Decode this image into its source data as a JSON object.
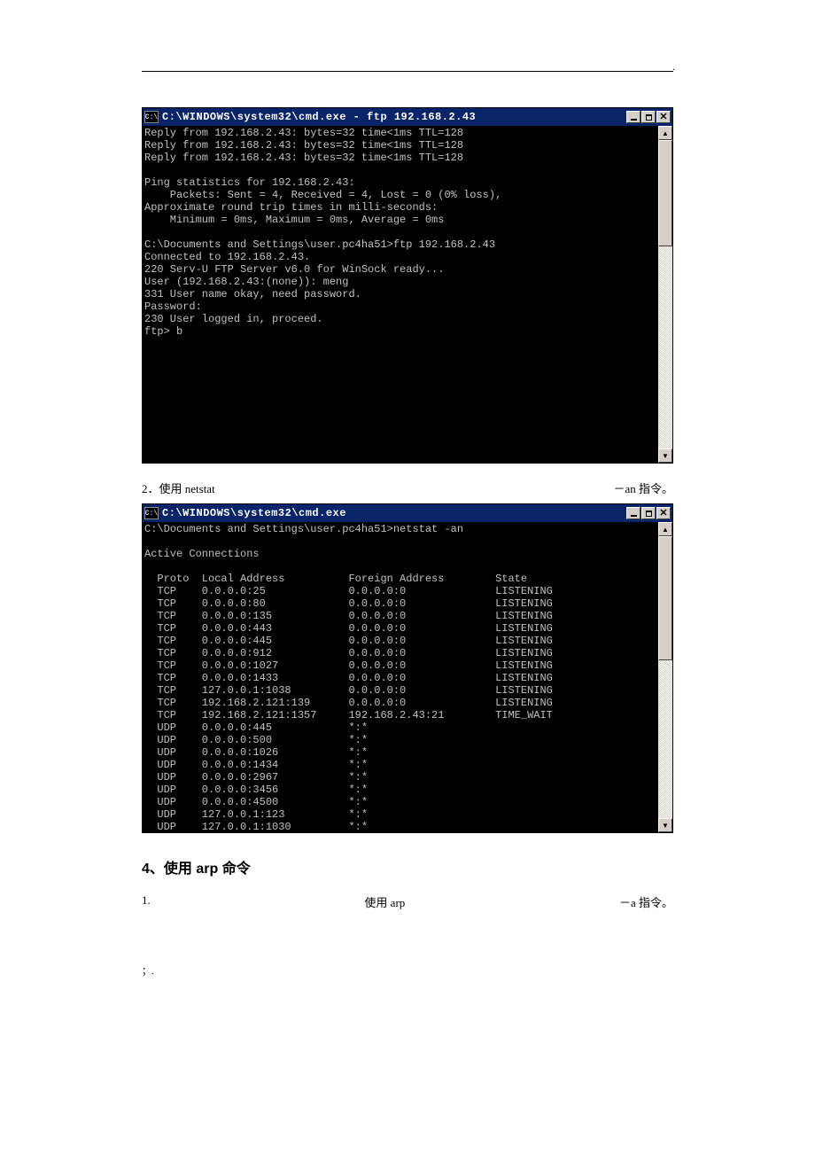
{
  "page_dot": ".",
  "cmd1": {
    "icon": "C:\\",
    "title": "C:\\WINDOWS\\system32\\cmd.exe - ftp 192.168.2.43",
    "lines": [
      "Reply from 192.168.2.43: bytes=32 time<1ms TTL=128",
      "Reply from 192.168.2.43: bytes=32 time<1ms TTL=128",
      "Reply from 192.168.2.43: bytes=32 time<1ms TTL=128",
      "",
      "Ping statistics for 192.168.2.43:",
      "    Packets: Sent = 4, Received = 4, Lost = 0 (0% loss),",
      "Approximate round trip times in milli-seconds:",
      "    Minimum = 0ms, Maximum = 0ms, Average = 0ms",
      "",
      "C:\\Documents and Settings\\user.pc4ha51>ftp 192.168.2.43",
      "Connected to 192.168.2.43.",
      "220 Serv-U FTP Server v6.0 for WinSock ready...",
      "User (192.168.2.43:(none)): meng",
      "331 User name okay, need password.",
      "Password:",
      "230 User logged in, proceed.",
      "ftp> b"
    ]
  },
  "step2": {
    "left": "2．使用 netstat",
    "right": "－an 指令。"
  },
  "cmd2": {
    "icon": "C:\\",
    "title": "C:\\WINDOWS\\system32\\cmd.exe",
    "prompt": "C:\\Documents and Settings\\user.pc4ha51>netstat -an",
    "heading": "Active Connections",
    "columns": {
      "c1": "Proto",
      "c2": "Local Address",
      "c3": "Foreign Address",
      "c4": "State"
    },
    "rows": [
      {
        "proto": "TCP",
        "local": "0.0.0.0:25",
        "foreign": "0.0.0.0:0",
        "state": "LISTENING"
      },
      {
        "proto": "TCP",
        "local": "0.0.0.0:80",
        "foreign": "0.0.0.0:0",
        "state": "LISTENING"
      },
      {
        "proto": "TCP",
        "local": "0.0.0.0:135",
        "foreign": "0.0.0.0:0",
        "state": "LISTENING"
      },
      {
        "proto": "TCP",
        "local": "0.0.0.0:443",
        "foreign": "0.0.0.0:0",
        "state": "LISTENING"
      },
      {
        "proto": "TCP",
        "local": "0.0.0.0:445",
        "foreign": "0.0.0.0:0",
        "state": "LISTENING"
      },
      {
        "proto": "TCP",
        "local": "0.0.0.0:912",
        "foreign": "0.0.0.0:0",
        "state": "LISTENING"
      },
      {
        "proto": "TCP",
        "local": "0.0.0.0:1027",
        "foreign": "0.0.0.0:0",
        "state": "LISTENING"
      },
      {
        "proto": "TCP",
        "local": "0.0.0.0:1433",
        "foreign": "0.0.0.0:0",
        "state": "LISTENING"
      },
      {
        "proto": "TCP",
        "local": "127.0.0.1:1038",
        "foreign": "0.0.0.0:0",
        "state": "LISTENING"
      },
      {
        "proto": "TCP",
        "local": "192.168.2.121:139",
        "foreign": "0.0.0.0:0",
        "state": "LISTENING"
      },
      {
        "proto": "TCP",
        "local": "192.168.2.121:1357",
        "foreign": "192.168.2.43:21",
        "state": "TIME_WAIT"
      },
      {
        "proto": "UDP",
        "local": "0.0.0.0:445",
        "foreign": "*:*",
        "state": ""
      },
      {
        "proto": "UDP",
        "local": "0.0.0.0:500",
        "foreign": "*:*",
        "state": ""
      },
      {
        "proto": "UDP",
        "local": "0.0.0.0:1026",
        "foreign": "*:*",
        "state": ""
      },
      {
        "proto": "UDP",
        "local": "0.0.0.0:1434",
        "foreign": "*:*",
        "state": ""
      },
      {
        "proto": "UDP",
        "local": "0.0.0.0:2967",
        "foreign": "*:*",
        "state": ""
      },
      {
        "proto": "UDP",
        "local": "0.0.0.0:3456",
        "foreign": "*:*",
        "state": ""
      },
      {
        "proto": "UDP",
        "local": "0.0.0.0:4500",
        "foreign": "*:*",
        "state": ""
      },
      {
        "proto": "UDP",
        "local": "127.0.0.1:123",
        "foreign": "*:*",
        "state": ""
      },
      {
        "proto": "UDP",
        "local": "127.0.0.1:1030",
        "foreign": "*:*",
        "state": ""
      }
    ]
  },
  "heading4": "4、使用 arp 命令",
  "step4_1": {
    "left": "1.",
    "mid": "使用 arp",
    "right": "－a 指令。"
  },
  "footer": "；."
}
